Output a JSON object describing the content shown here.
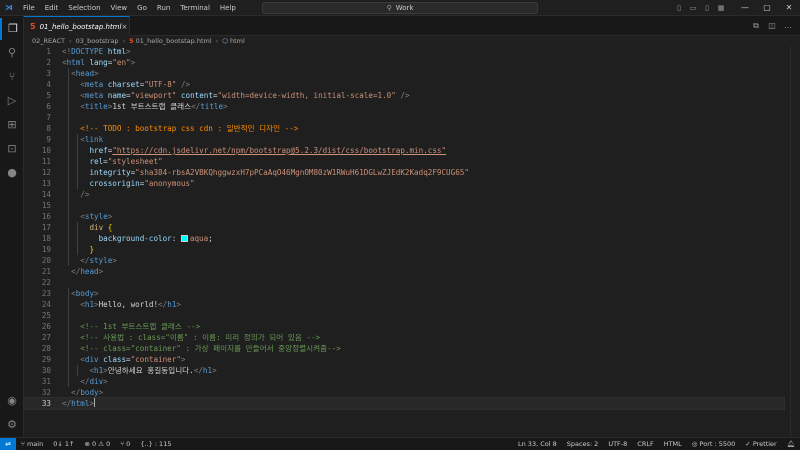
{
  "titlebar": {
    "app_icon": "vscode-logo",
    "menu": [
      "File",
      "Edit",
      "Selection",
      "View",
      "Go",
      "Run",
      "Terminal",
      "Help"
    ],
    "search_text": "Work"
  },
  "activity_bar": {
    "icons": [
      "explorer-icon",
      "search-icon",
      "source-control-icon",
      "run-debug-icon",
      "extensions-icon",
      "remote-explorer-icon",
      "github-icon",
      "account-icon",
      "settings-gear-icon"
    ]
  },
  "tab": {
    "filename": "01_hello_bootstap.html",
    "close": "×"
  },
  "breadcrumb": {
    "parts": [
      "02_REACT",
      "03_bootstrap",
      "01_hello_bootstap.html",
      "html"
    ]
  },
  "editor": {
    "current_line": 33,
    "lines": [
      {
        "n": "1"
      },
      {
        "n": "2"
      },
      {
        "n": "3"
      },
      {
        "n": "4"
      },
      {
        "n": "5"
      },
      {
        "n": "6"
      },
      {
        "n": "7"
      },
      {
        "n": "8"
      },
      {
        "n": "9"
      },
      {
        "n": "10"
      },
      {
        "n": "11"
      },
      {
        "n": "12"
      },
      {
        "n": "13"
      },
      {
        "n": "14"
      },
      {
        "n": "15"
      },
      {
        "n": "16"
      },
      {
        "n": "17"
      },
      {
        "n": "18"
      },
      {
        "n": "19"
      },
      {
        "n": "20"
      },
      {
        "n": "21"
      },
      {
        "n": "22"
      },
      {
        "n": "23"
      },
      {
        "n": "24"
      },
      {
        "n": "25"
      },
      {
        "n": "26"
      },
      {
        "n": "27"
      },
      {
        "n": "28"
      },
      {
        "n": "29"
      },
      {
        "n": "30"
      },
      {
        "n": "31"
      },
      {
        "n": "32"
      },
      {
        "n": "33"
      }
    ],
    "code": {
      "l1_doctype": "DOCTYPE",
      "l1_html": "html",
      "l2_tag": "html",
      "l2_attr": "lang",
      "l2_val": "\"en\"",
      "l3_tag": "head",
      "l4_tag": "meta",
      "l4_attr": "charset",
      "l4_val": "\"UTF-8\"",
      "l5_tag": "meta",
      "l5_attr1": "name",
      "l5_val1": "\"viewport\"",
      "l5_attr2": "content",
      "l5_val2": "\"width=device-width, initial-scale=1.0\"",
      "l6_tag": "title",
      "l6_text": "1st 부트스트랩 클래스",
      "l8_comment_start": "<!-- ",
      "l8_todo": "TODO : bootstrap css cdn : 일반적인 디자인",
      "l8_comment_end": " -->",
      "l9_tag": "link",
      "l10_attr": "href",
      "l10_val": "\"https://cdn.jsdelivr.net/npm/bootstrap@5.2.3/dist/css/bootstrap.min.css\"",
      "l11_attr": "rel",
      "l11_val": "\"stylesheet\"",
      "l12_attr": "integrity",
      "l12_val": "\"sha384-rbsA2VBKQhggwzxH7pPCaAqO46MgnOM80zW1RWuH61DGLwZJEdK2Kadq2F9CUG65\"",
      "l13_attr": "crossorigin",
      "l13_val": "\"anonymous\"",
      "l14_close": "/>",
      "l16_tag": "style",
      "l17_sel": "div",
      "l18_prop": "background-color",
      "l18_val": "aqua",
      "l20_tag": "style",
      "l21_tag": "head",
      "l23_tag": "body",
      "l24_tag": "h1",
      "l24_text": "Hello, world!",
      "l26_comment": "<!-- 1st 부트스트랩 클래스 -->",
      "l27_comment": "<!-- 사용법 : class=\"이름\" : 이름: 미리 정의가 되어 있음 -->",
      "l28_comment": "<!-- class=\"container\" : 가상 페이지를 만들어서 중앙정렬시켜줌-->",
      "l29_tag": "div",
      "l29_attr": "class",
      "l29_val": "\"container\"",
      "l30_tag": "h1",
      "l30_text": "안녕하세요 홍길동입니다.",
      "l31_tag": "div",
      "l32_tag": "body",
      "l33_tag": "html"
    }
  },
  "statusbar": {
    "branch": "main",
    "sync": "0↓ 1↑",
    "errors": "⊗ 0",
    "warnings": "⚠ 0",
    "ports": "⑂ 0",
    "selection": "{..} : 115",
    "position": "Ln 33, Col 8",
    "spaces": "Spaces: 2",
    "encoding": "UTF-8",
    "eol": "CRLF",
    "language": "HTML",
    "live_server": "Port : 5500",
    "prettier": "Prettier",
    "accent": "#0078d4"
  }
}
